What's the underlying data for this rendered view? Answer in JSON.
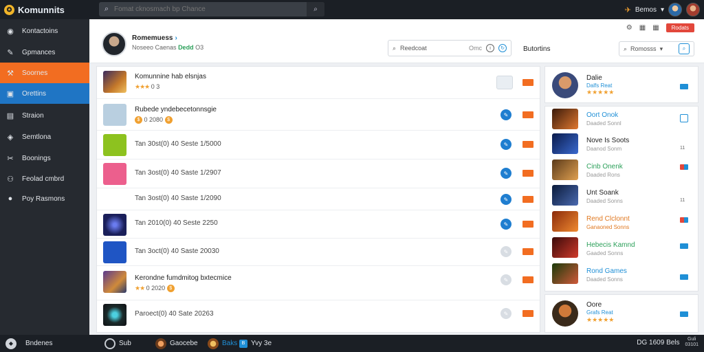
{
  "app": {
    "name": "Komunnits",
    "logo_glyph": "✪"
  },
  "search": {
    "placeholder": "Fomat cknosmach bp Chance"
  },
  "top_user": {
    "name": "Bemos"
  },
  "sidebar": {
    "items": [
      {
        "label": "Kontactoins",
        "icon": "dashboard-icon"
      },
      {
        "label": "Gpmances",
        "icon": "tool-icon"
      },
      {
        "label": "Soornes",
        "icon": "hammer-icon",
        "state": "active-orange"
      },
      {
        "label": "Orettins",
        "icon": "chat-icon",
        "state": "active-blue"
      },
      {
        "label": "Straion",
        "icon": "list-icon"
      },
      {
        "label": "Semtlona",
        "icon": "settings-icon"
      },
      {
        "label": "Boonings",
        "icon": "tools-icon"
      },
      {
        "label": "Feolad cmbrd",
        "icon": "users-icon"
      },
      {
        "label": "Poy Rasmons",
        "icon": "pay-icon"
      }
    ]
  },
  "profile": {
    "name": "Romemuess",
    "meta_prefix": "Noseeo Caenas",
    "meta_green": "Dedd",
    "meta_suffix": "O3"
  },
  "header": {
    "search_label": "Reedcoat",
    "search_ghost": "Omc",
    "section_title": "Butortins",
    "filter_label": "Romosss",
    "action_button": "Rodats"
  },
  "list": [
    {
      "title": "Komunnine hab elsnjas",
      "sub": "0 3",
      "has_stars": true,
      "thumb": "hero",
      "action": "square"
    },
    {
      "title": "Rubede yndebecetonnsgie",
      "sub": "0 2080",
      "has_coin": true,
      "thumb": "placeholder",
      "action": "blue"
    },
    {
      "text": "Tan 30st(0) 40 Seste 1/5000",
      "thumb": "green",
      "action": "blue"
    },
    {
      "text": "Tan 3ost(0) 40 Saste 1/2907",
      "thumb": "pink",
      "action": "blue"
    },
    {
      "text": "Tan 3ost(0) 40 Saste 1/2090",
      "thumb": "none",
      "action": "blue"
    },
    {
      "text": "Tan 2010(0) 40 Seste 2250",
      "thumb": "navy",
      "action": "blue"
    },
    {
      "text": "Tan 3oct(0) 40 Saste 20030",
      "thumb": "bluebox",
      "action": "grey"
    },
    {
      "title": "Kerondne fumdmitog bxtecmice",
      "sub": "0 2020",
      "has_stars": true,
      "has_coin": true,
      "thumb": "scene",
      "action": "grey"
    },
    {
      "text": "Paroect(0) 40 Sate 20263",
      "thumb": "eye",
      "action": "grey"
    }
  ],
  "right": {
    "top_card": {
      "name": "Dalie",
      "sub": "Dalfs Reat",
      "rating": "★★★★★"
    },
    "items": [
      {
        "name": "Oort Onok",
        "sub": "Daaded Sonnl",
        "color": "blue",
        "badge": "outline"
      },
      {
        "name": "Nove Is Soots",
        "sub": "Daanod Sonm",
        "color": "default",
        "badge": "num"
      },
      {
        "name": "Cinb Onenk",
        "sub": "Daaded Rons",
        "color": "green",
        "badge": "red"
      },
      {
        "name": "Unt Soank",
        "sub": "Daaded Sonns",
        "color": "default",
        "badge": "num"
      },
      {
        "name": "Rend Clclonnt",
        "sub": "Ganaoned Sonns",
        "color": "green",
        "badge": "red"
      },
      {
        "name": "Hebecis Kamnd",
        "sub": "Gaaded Sonns",
        "color": "green",
        "badge": "num"
      },
      {
        "name": "Rond Games",
        "sub": "Daaded Sonns",
        "color": "blue",
        "badge": "mini"
      }
    ],
    "bottom_card": {
      "name": "Oore",
      "sub": "Grafs Reat",
      "rating": "★★★★★"
    }
  },
  "bottombar": {
    "left_label": "Bndenes",
    "tabs": [
      {
        "label": "Sub",
        "icon": "disk-icon"
      },
      {
        "label": "Gaocebe",
        "icon": "avatar-icon"
      },
      {
        "label": "Baks",
        "icon": "avatar-icon"
      },
      {
        "label": "Yvy 3e",
        "icon": "bold-icon"
      }
    ],
    "right_label": "DG 1609 Bels",
    "clock_top": "Guli",
    "clock_bottom": "03101"
  },
  "colors": {
    "accent_orange": "#f26d21",
    "accent_blue": "#1f75c4",
    "topbar": "#1b1f25",
    "sidebar": "#262a30"
  }
}
